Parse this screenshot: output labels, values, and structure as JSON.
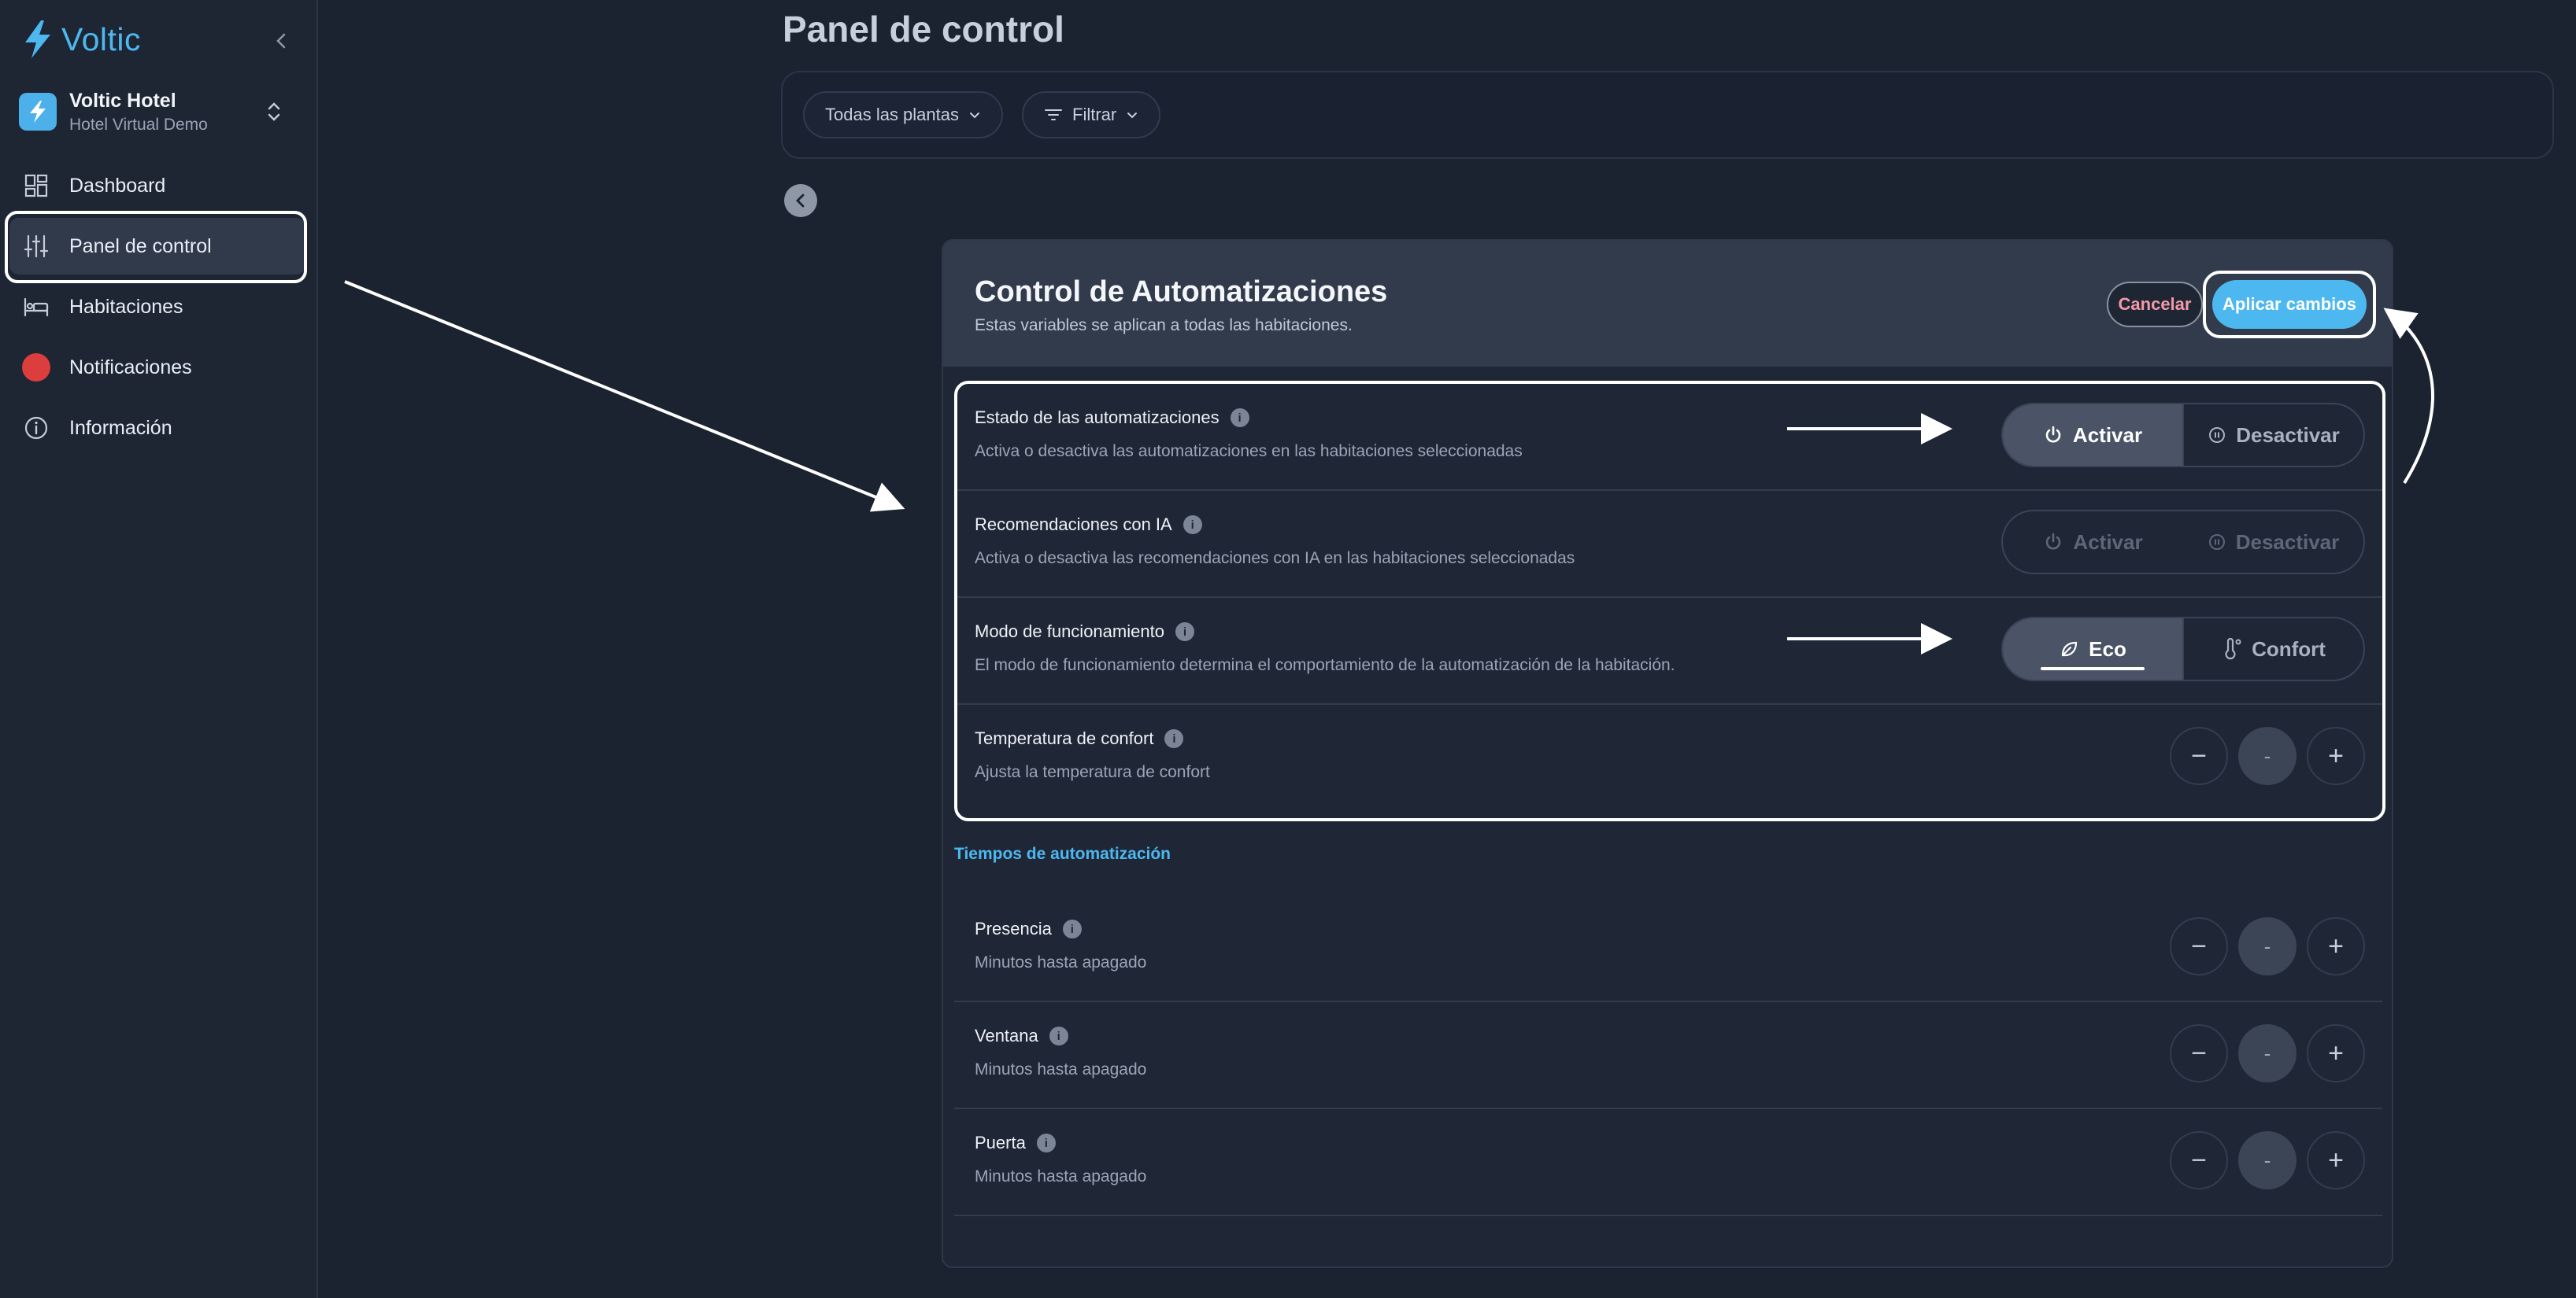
{
  "sidebar": {
    "brand": "Voltic",
    "hotel_name": "Voltic Hotel",
    "hotel_sub": "Hotel Virtual Demo",
    "items": [
      {
        "label": "Dashboard",
        "icon": "dashboard-icon"
      },
      {
        "label": "Panel de control",
        "icon": "sliders-icon",
        "active": true
      },
      {
        "label": "Habitaciones",
        "icon": "bed-icon"
      },
      {
        "label": "Notificaciones",
        "icon": "notification-dot-icon"
      },
      {
        "label": "Información",
        "icon": "info-circle-icon"
      }
    ]
  },
  "header": {
    "title": "Panel de control",
    "floors_label": "Todas las plantas",
    "filter_label": "Filtrar"
  },
  "card": {
    "title": "Control de Automatizaciones",
    "subtitle": "Estas variables se aplican a todas las habitaciones.",
    "cancel_label": "Cancelar",
    "apply_label": "Aplicar cambios",
    "settings": [
      {
        "label": "Estado de las automatizaciones",
        "desc": "Activa o desactiva las automatizaciones en las habitaciones seleccionadas",
        "options": [
          "Activar",
          "Desactivar"
        ],
        "selected": "Activar"
      },
      {
        "label": "Recomendaciones con IA",
        "desc": "Activa o desactiva las recomendaciones con IA en las habitaciones seleccionadas",
        "options": [
          "Activar",
          "Desactivar"
        ],
        "selected": null,
        "disabled": true
      },
      {
        "label": "Modo de funcionamiento",
        "desc": "El modo de funcionamiento determina el comportamiento de la automatización de la habitación.",
        "options": [
          "Eco",
          "Confort"
        ],
        "selected": "Eco"
      },
      {
        "label": "Temperatura de confort",
        "desc": "Ajusta la temperatura de confort",
        "value": "-"
      }
    ],
    "timing_title": "Tiempos de automatización",
    "timings": [
      {
        "label": "Presencia",
        "desc": "Minutos hasta apagado",
        "value": "-"
      },
      {
        "label": "Ventana",
        "desc": "Minutos hasta apagado",
        "value": "-"
      },
      {
        "label": "Puerta",
        "desc": "Minutos hasta apagado",
        "value": "-"
      }
    ]
  },
  "colors": {
    "accent": "#4cb8ef",
    "cancel_text": "#f39aa8",
    "notification": "#dc3d3d"
  }
}
